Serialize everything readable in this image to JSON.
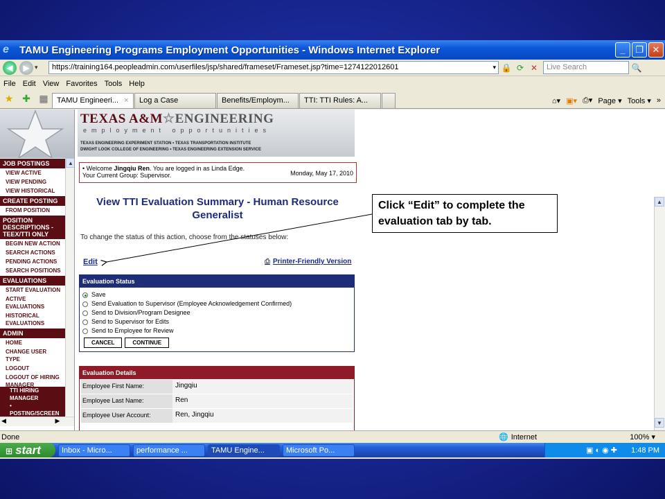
{
  "window": {
    "title": "TAMU Engineering Programs Employment Opportunities - Windows Internet Explorer",
    "minimize": "_",
    "maximize": "❐",
    "close": "✕"
  },
  "address": {
    "url": "https://training164.peopleadmin.com/userfiles/jsp/shared/frameset/Frameset.jsp?time=1274122012601",
    "search_placeholder": "Live Search"
  },
  "menu": [
    "File",
    "Edit",
    "View",
    "Favorites",
    "Tools",
    "Help"
  ],
  "tabs": [
    {
      "label": "TAMU Engineeri...",
      "close": "×"
    },
    {
      "label": "Log a Case"
    },
    {
      "label": "Benefits/Employm..."
    },
    {
      "label": "TTI: TTI Rules: A..."
    }
  ],
  "command_bar": {
    "page": "Page ▾",
    "tools": "Tools ▾",
    "more": "»"
  },
  "left_nav": {
    "sections": [
      {
        "head": "JOB POSTINGS",
        "items": [
          "VIEW ACTIVE",
          "VIEW PENDING",
          "VIEW HISTORICAL"
        ]
      },
      {
        "head": "CREATE POSTING",
        "items": [
          "FROM POSITION"
        ]
      },
      {
        "head": "POSITION DESCRIPTIONS - TEEX/TTI ONLY",
        "items": [
          "BEGIN NEW ACTION",
          "SEARCH ACTIONS",
          "PENDING ACTIONS",
          "SEARCH POSITIONS"
        ]
      },
      {
        "head": "EVALUATIONS",
        "items": [
          "START EVALUATION",
          "ACTIVE EVALUATIONS",
          "HISTORICAL EVALUATIONS"
        ]
      },
      {
        "head": "ADMIN",
        "items": [
          "HOME",
          "CHANGE USER TYPE",
          "LOGOUT",
          "LOGOUT OF HIRING MANAGER"
        ]
      }
    ],
    "sub": [
      "TTI HIRING MANAGER",
      "• POSTING/SCREEN APPLICANTS"
    ]
  },
  "banner": {
    "title_a": "TEXAS A&M",
    "title_b": "ENGINEERING",
    "sub": "employment opportunities",
    "line1": "TEXAS ENGINEERING EXPERIMENT STATION • TEXAS TRANSPORTATION INSTITUTE",
    "line2": "DWIGHT LOOK COLLEGE OF ENGINEERING • TEXAS ENGINEERING EXTENSION SERVICE"
  },
  "welcome": {
    "line1_pre": "• Welcome ",
    "user": "Jingqiu Ren",
    "line1_post": ". You are logged in as Linda Edge.",
    "line2": "Your Current Group: Supervisor.",
    "date": "Monday, May 17, 2010"
  },
  "page": {
    "heading_line1": "View TTI Evaluation Summary - Human Resource",
    "heading_line2": "Generalist",
    "instruction": "To change the status of this action, choose from the statuses below:",
    "edit": "Edit",
    "printer": "Printer-Friendly Version"
  },
  "eval_status": {
    "title": "Evaluation Status",
    "options": [
      {
        "label": "Save",
        "selected": true
      },
      {
        "label": "Send Evaluation to Supervisor (Employee Acknowledgement Confirmed)",
        "selected": false
      },
      {
        "label": "Send to Division/Program Designee",
        "selected": false
      },
      {
        "label": "Send to Supervisor for Edits",
        "selected": false
      },
      {
        "label": "Send to Employee for Review",
        "selected": false
      }
    ],
    "cancel": "CANCEL",
    "continue": "CONTINUE"
  },
  "eval_details": {
    "title": "Evaluation Details",
    "rows": [
      {
        "label": "Employee First Name:",
        "value": "Jingqiu"
      },
      {
        "label": "Employee Last Name:",
        "value": "Ren"
      },
      {
        "label": "Employee User Account:",
        "value": "Ren, Jingqiu"
      }
    ]
  },
  "callout": "Click “Edit” to complete the evaluation tab by tab.",
  "statusbar": {
    "left": "Done",
    "zone": "Internet",
    "zoom": "100%"
  },
  "taskbar": {
    "start": "start",
    "items": [
      "Inbox - Micro...",
      "performance ...",
      "TAMU Engine...",
      "Microsoft Po..."
    ],
    "clock": "1:48 PM"
  }
}
